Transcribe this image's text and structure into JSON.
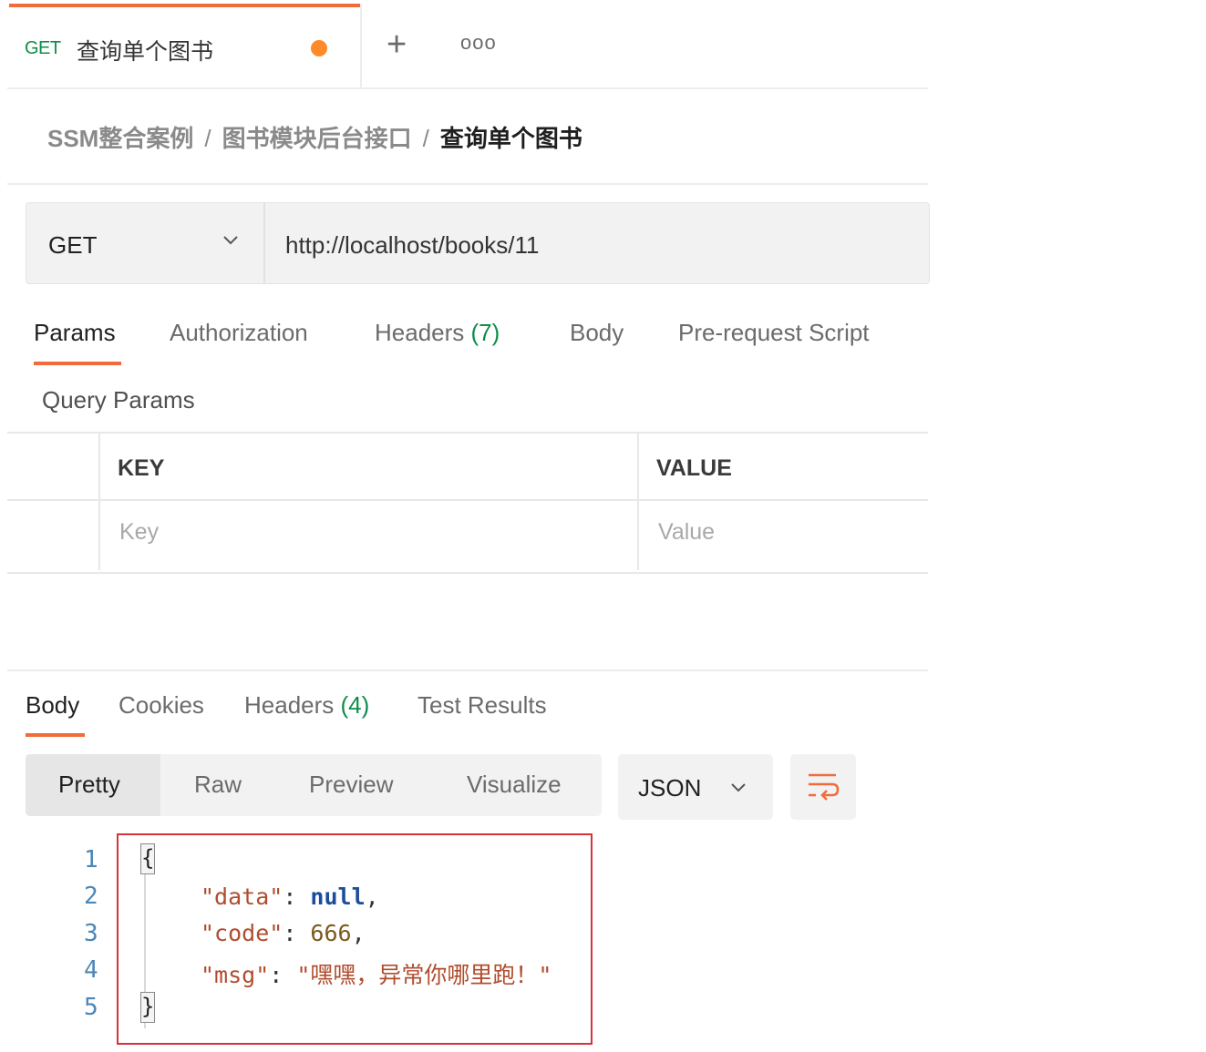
{
  "tab": {
    "method": "GET",
    "title": "查询单个图书",
    "plus": "+",
    "more": "ooo"
  },
  "breadcrumb": {
    "items": [
      "SSM整合案例",
      "图书模块后台接口",
      "查询单个图书"
    ],
    "separator": "/"
  },
  "request": {
    "method": "GET",
    "url": "http://localhost/books/11"
  },
  "request_tabs": [
    {
      "label": "Params",
      "count": ""
    },
    {
      "label": "Authorization",
      "count": ""
    },
    {
      "label": "Headers",
      "count": "(7)"
    },
    {
      "label": "Body",
      "count": ""
    },
    {
      "label": "Pre-request Script",
      "count": ""
    }
  ],
  "query_params": {
    "title": "Query Params",
    "headers": {
      "key": "KEY",
      "value": "VALUE"
    },
    "placeholders": {
      "key": "Key",
      "value": "Value"
    }
  },
  "response_tabs": [
    {
      "label": "Body",
      "count": ""
    },
    {
      "label": "Cookies",
      "count": ""
    },
    {
      "label": "Headers",
      "count": "(4)"
    },
    {
      "label": "Test Results",
      "count": ""
    }
  ],
  "format_tabs": [
    "Pretty",
    "Raw",
    "Preview",
    "Visualize"
  ],
  "format_select": "JSON",
  "code": {
    "line_numbers": [
      "1",
      "2",
      "3",
      "4",
      "5"
    ],
    "open_brace": "{",
    "close_brace": "}",
    "data_key": "\"data\"",
    "data_value": "null",
    "code_key": "\"code\"",
    "code_value": "666",
    "msg_key": "\"msg\"",
    "msg_value": "\"嘿嘿，异常你哪里跑！\"",
    "colon": ": ",
    "comma": ","
  },
  "colors": {
    "accent": "#f26b3a",
    "get_green": "#0f8c4a",
    "unsaved_dot": "#ff8a2a",
    "highlight_box": "#d9303a"
  },
  "icons": [
    "chevron-down-icon",
    "plus-icon",
    "more-icon",
    "wrap-lines-icon"
  ]
}
